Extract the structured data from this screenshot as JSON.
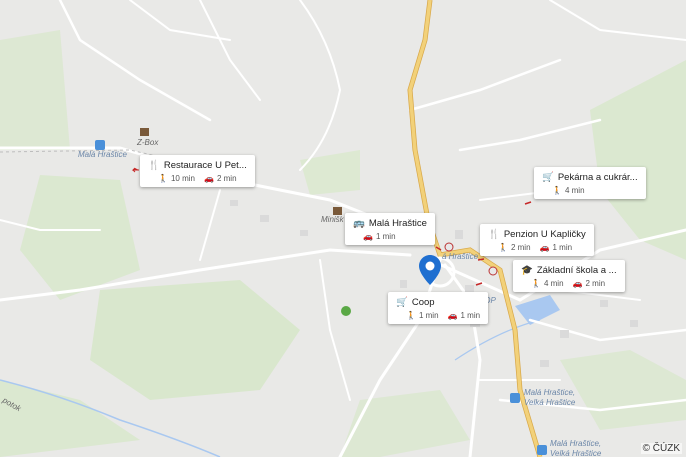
{
  "map": {
    "copyright": "© ČÚZK",
    "place_labels": {
      "z_box": "Z-Box",
      "mala_hrastice_west": "Malá Hraštice",
      "minisko": "Minišk",
      "mala_hrastice_center": "á Hraštice",
      "coop": "OOP",
      "potok": "potok",
      "bus_stop_1a": "Malá Hraštice,",
      "bus_stop_1b": "Velká Hraštice",
      "bus_stop_2a": "Malá Hraštice,",
      "bus_stop_2b": "Velká Hraštice"
    },
    "cards": [
      {
        "id": "restaurace",
        "icon": "cutlery-icon",
        "title": "Restaurace U Pet...",
        "walk": "10 min",
        "drive": "2 min"
      },
      {
        "id": "mala-hrastice",
        "icon": "bus-icon",
        "title": "Malá Hraštice",
        "walk": "",
        "drive": "1 min"
      },
      {
        "id": "pekarna",
        "icon": "cart-icon",
        "title": "Pekárna a cukrár...",
        "walk": "4 min",
        "drive": ""
      },
      {
        "id": "penzion",
        "icon": "cutlery-icon",
        "title": "Penzion U Kapličky",
        "walk": "2 min",
        "drive": "1 min"
      },
      {
        "id": "zakladni-skola",
        "icon": "school-icon",
        "title": "Základní škola a ...",
        "walk": "4 min",
        "drive": "2 min"
      },
      {
        "id": "coop",
        "icon": "cart-icon",
        "title": "Coop",
        "walk": "1 min",
        "drive": "1 min"
      }
    ],
    "colors": {
      "main_road": "#f2d17a",
      "main_road_edge": "#d9a94a",
      "road": "#ffffff",
      "forest": "#d6e8c9",
      "water": "#a9c8f0",
      "pin": "#1f6fd0"
    }
  }
}
